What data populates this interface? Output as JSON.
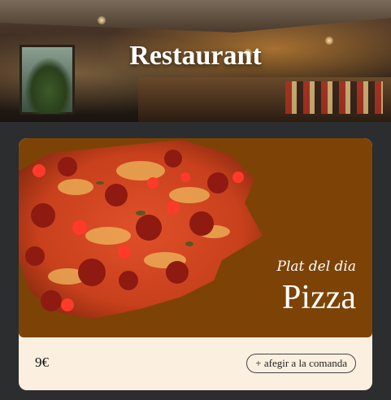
{
  "header": {
    "title": "Restaurant"
  },
  "menu_card": {
    "tagline": "Plat del dia",
    "dish": "Pizza",
    "price": "9€",
    "add_button_label": "+ afegir a la comanda"
  },
  "colors": {
    "page_bg": "#2b2d2e",
    "card_media_bg": "#7d4306",
    "card_bg": "#fbefe0"
  }
}
